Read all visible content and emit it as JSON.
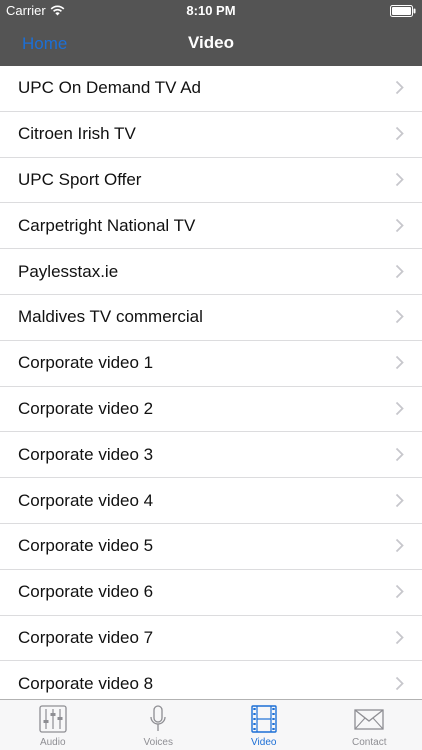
{
  "status_bar": {
    "carrier": "Carrier",
    "time": "8:10 PM"
  },
  "nav": {
    "back_label": "Home",
    "title": "Video"
  },
  "list_items": [
    "UPC On Demand TV Ad",
    "Citroen Irish TV",
    "UPC Sport Offer",
    "Carpetright National TV",
    "Paylesstax.ie",
    "Maldives TV commercial",
    "Corporate video 1",
    "Corporate video 2",
    "Corporate video 3",
    "Corporate video 4",
    "Corporate video 5",
    "Corporate video 6",
    "Corporate video 7",
    "Corporate video 8"
  ],
  "tabs": [
    {
      "label": "Audio",
      "icon": "mixer-sliders-icon"
    },
    {
      "label": "Voices",
      "icon": "microphone-icon"
    },
    {
      "label": "Video",
      "icon": "film-strip-icon"
    },
    {
      "label": "Contact",
      "icon": "envelope-icon"
    }
  ],
  "active_tab": "Video",
  "colors": {
    "header_bg": "#545454",
    "accent": "#1c6fd6",
    "tab_inactive": "#8e8e93"
  }
}
